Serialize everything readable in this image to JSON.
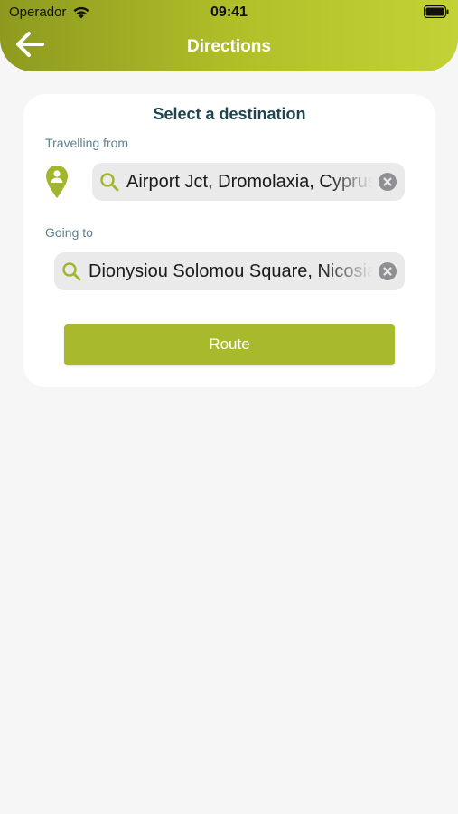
{
  "status_bar": {
    "carrier": "Operador",
    "time": "09:41"
  },
  "header": {
    "title": "Directions",
    "back_icon": "arrow-left-icon",
    "gradient_colors": [
      "#8d9a1f",
      "#c3d236"
    ]
  },
  "card": {
    "title": "Select a destination",
    "from": {
      "label": "Travelling from",
      "value": "Airport Jct, Dromolaxia, Cyprus",
      "pin_icon": "user-location-pin-icon"
    },
    "to": {
      "label": "Going to",
      "value": "Dionysiou Solomou Square, Nicosia"
    },
    "route_button": "Route"
  },
  "colors": {
    "accent": "#a9b92e",
    "title_text": "#1f4550",
    "label_text": "#5f8190",
    "background": "#f6f6f6"
  }
}
